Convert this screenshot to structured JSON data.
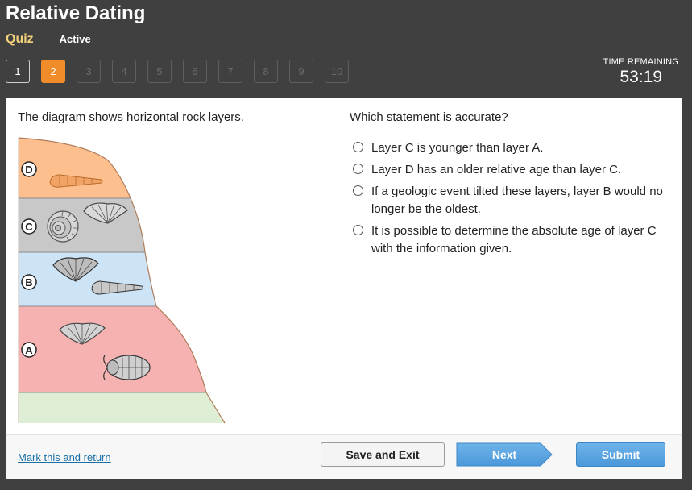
{
  "header": {
    "title": "Relative Dating",
    "quiz_label": "Quiz",
    "status": "Active"
  },
  "question_nav": [
    {
      "label": "1",
      "state": "visited"
    },
    {
      "label": "2",
      "state": "current"
    },
    {
      "label": "3",
      "state": "unvisited"
    },
    {
      "label": "4",
      "state": "unvisited"
    },
    {
      "label": "5",
      "state": "unvisited"
    },
    {
      "label": "6",
      "state": "unvisited"
    },
    {
      "label": "7",
      "state": "unvisited"
    },
    {
      "label": "8",
      "state": "unvisited"
    },
    {
      "label": "9",
      "state": "unvisited"
    },
    {
      "label": "10",
      "state": "unvisited"
    }
  ],
  "timer": {
    "label": "TIME REMAINING",
    "value": "53:19"
  },
  "content": {
    "prompt": "The diagram shows horizontal rock layers.",
    "question": "Which statement is accurate?",
    "diagram": {
      "layers": [
        {
          "label": "D",
          "color": "#fdbf8e",
          "fossils": [
            "horn-shell-fossil-icon"
          ]
        },
        {
          "label": "C",
          "color": "#c8c8c8",
          "fossils": [
            "ammonite-fossil-icon",
            "brachiopod-fossil-icon"
          ]
        },
        {
          "label": "B",
          "color": "#cde4f6",
          "fossils": [
            "brachiopod-fossil-icon",
            "horn-shell-fossil-icon"
          ]
        },
        {
          "label": "A",
          "color": "#f6b1b1",
          "fossils": [
            "brachiopod-fossil-icon",
            "trilobite-fossil-icon"
          ]
        }
      ],
      "base_color": "#ddeed5"
    },
    "options": [
      "Layer C is younger than layer A.",
      "Layer D has an older relative age than layer C.",
      "If a geologic event tilted these layers, layer B would no longer be the oldest.",
      "It is possible to determine the absolute age of layer C with the information given."
    ]
  },
  "footer": {
    "mark_link": "Mark this and return",
    "save_exit": "Save and Exit",
    "next": "Next",
    "submit": "Submit"
  }
}
